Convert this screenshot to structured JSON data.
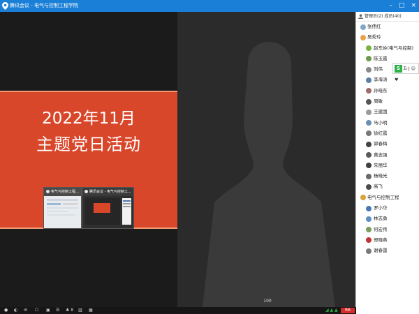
{
  "window": {
    "title": "腾讯会议 - 电气与控制工程学院"
  },
  "slide": {
    "year": "2022年11月",
    "title": "主题党日活动",
    "thumbs": [
      {
        "label": "电气与控制工程..."
      },
      {
        "label": "腾讯会议 - 电气与控制工..."
      }
    ]
  },
  "video": {
    "badge": "100"
  },
  "panel": {
    "header": "管理员(2)  成员(40)",
    "participants": [
      {
        "name": "张伟红",
        "color": "#7fa6c9",
        "level": 0
      },
      {
        "name": "吴秀玲",
        "color": "#e9a14a",
        "level": 0
      },
      {
        "name": "赵东岭(电气与控制)",
        "color": "#78b33f",
        "level": 1
      },
      {
        "name": "陈玉霞",
        "color": "#6e9a4a",
        "level": 1
      },
      {
        "name": "刘伟",
        "color": "#8a8a8a",
        "level": 1
      },
      {
        "name": "李海涛",
        "color": "#5d7fa8",
        "level": 1
      },
      {
        "name": "孙晓东",
        "color": "#a06b6b",
        "level": 1
      },
      {
        "name": "周敏",
        "color": "#555555",
        "level": 1
      },
      {
        "name": "王建国",
        "color": "#9a9a9a",
        "level": 1
      },
      {
        "name": "马小明",
        "color": "#6b8fb2",
        "level": 1
      },
      {
        "name": "徐红霞",
        "color": "#777777",
        "level": 1
      },
      {
        "name": "郭春梅",
        "color": "#444444",
        "level": 1
      },
      {
        "name": "黄志强",
        "color": "#5a5a5a",
        "level": 1
      },
      {
        "name": "朱丽华",
        "color": "#3f3f3f",
        "level": 1
      },
      {
        "name": "杨晓光",
        "color": "#6a6a6a",
        "level": 1
      },
      {
        "name": "高飞",
        "color": "#4b4b4b",
        "level": 1
      },
      {
        "name": "电气与控制工程",
        "color": "#d9a13c",
        "level": 0
      },
      {
        "name": "罗小华",
        "color": "#4a78b5",
        "level": 1
      },
      {
        "name": "林志勇",
        "color": "#5f8fc0",
        "level": 1
      },
      {
        "name": "何宏伟",
        "color": "#7b9e5a",
        "level": 1
      },
      {
        "name": "郑晓燕",
        "color": "#c33333",
        "level": 1
      },
      {
        "name": "谢春雷",
        "color": "#7a7a7a",
        "level": 1
      }
    ],
    "float_chip": {
      "badge": "S",
      "text": "五·J ☺ ♥"
    }
  },
  "bottombar": {
    "items": [
      {
        "name": "mic-icon",
        "glyph": "●"
      },
      {
        "name": "mic-mute-icon",
        "glyph": "◐"
      },
      {
        "name": "camera-icon",
        "glyph": "✉"
      },
      {
        "name": "share-icon",
        "glyph": "☐"
      },
      {
        "name": "screen-icon",
        "glyph": "▣"
      },
      {
        "name": "record-icon",
        "glyph": "☰"
      },
      {
        "name": "members-icon",
        "glyph": "♣ 8"
      },
      {
        "name": "chat-icon",
        "glyph": "▥"
      },
      {
        "name": "apps-icon",
        "glyph": "▦"
      }
    ],
    "signal": "◢ ▲ ▲",
    "badge": "R6"
  }
}
